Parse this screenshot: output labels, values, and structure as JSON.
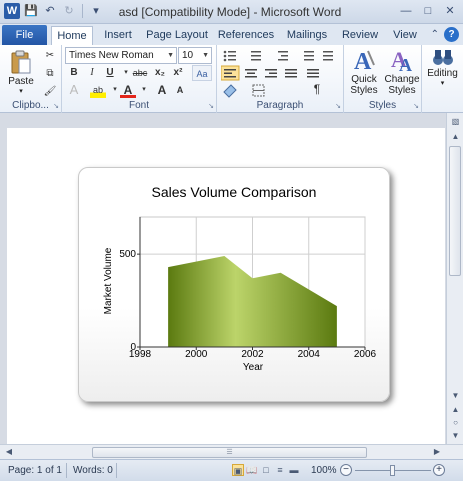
{
  "window": {
    "title": "asd [Compatibility Mode]  -  Microsoft Word",
    "app_logo": "W",
    "controls": {
      "minimize": "—",
      "maximize": "□",
      "close": "✕"
    }
  },
  "tabs": {
    "file": "File",
    "items": [
      "Home",
      "Insert",
      "Page Layout",
      "References",
      "Mailings",
      "Review",
      "View"
    ],
    "active": "Home"
  },
  "ribbon": {
    "clipboard": {
      "label": "Clipbo...",
      "paste": "Paste"
    },
    "font": {
      "label": "Font",
      "font_name": "Times New Roman",
      "font_size": "10",
      "bold": "B",
      "italic": "I",
      "underline": "U",
      "strike": "abc",
      "subscript": "x₂",
      "superscript": "x²",
      "grow": "A",
      "shrink": "A",
      "clear": "A",
      "highlight": "ab",
      "font_color": "A",
      "case": "Aa"
    },
    "paragraph": {
      "label": "Paragraph",
      "pilcrow": "¶"
    },
    "styles": {
      "label": "Styles",
      "quick": "Quick Styles",
      "change": "Change Styles"
    },
    "editing": {
      "label": "Editing"
    }
  },
  "chart_data": {
    "type": "area",
    "title": "Sales Volume Comparison",
    "xlabel": "Year",
    "ylabel": "Market Volume",
    "x": [
      1999,
      2001,
      2002,
      2003,
      2005
    ],
    "values": [
      430,
      490,
      370,
      400,
      220
    ],
    "xlim": [
      1998,
      2006
    ],
    "ylim": [
      0,
      700
    ],
    "xticks": [
      1998,
      2000,
      2002,
      2004,
      2006
    ],
    "yticks": [
      0,
      500
    ],
    "grid": true,
    "colors": {
      "fill_dark": "#5b7a10",
      "fill_light": "#bcd46a"
    }
  },
  "status": {
    "page": "Page: 1 of 1",
    "words": "Words: 0",
    "zoom": "100%"
  }
}
